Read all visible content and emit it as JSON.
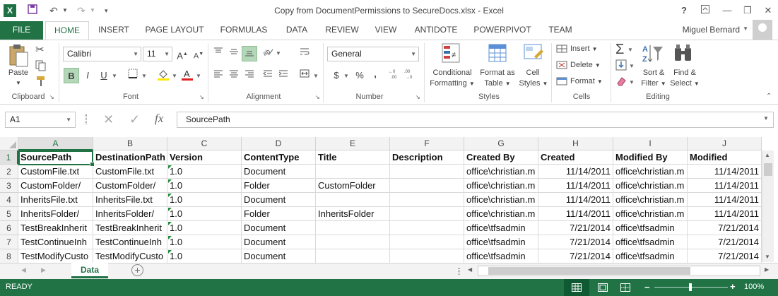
{
  "window": {
    "title": "Copy from DocumentPermissions to SecureDocs.xlsx - Excel",
    "app_icon_letter": "X",
    "help": "?"
  },
  "tabs": [
    "FILE",
    "HOME",
    "INSERT",
    "PAGE LAYOUT",
    "FORMULAS",
    "DATA",
    "REVIEW",
    "VIEW",
    "ANTIDOTE",
    "POWERPIVOT",
    "TEAM"
  ],
  "user": {
    "name": "Miguel Bernard"
  },
  "ribbon": {
    "clipboard": {
      "label": "Clipboard",
      "paste": "Paste"
    },
    "font": {
      "label": "Font",
      "name": "Calibri",
      "size": "11",
      "bold": "B",
      "italic": "I",
      "underline": "U"
    },
    "alignment": {
      "label": "Alignment"
    },
    "number": {
      "label": "Number",
      "format": "General",
      "currency": "$",
      "percent": "%",
      "comma": ","
    },
    "styles": {
      "label": "Styles",
      "conditional": [
        "Conditional",
        "Formatting"
      ],
      "format_table": [
        "Format as",
        "Table"
      ],
      "cell_styles": [
        "Cell",
        "Styles"
      ]
    },
    "cells": {
      "label": "Cells",
      "insert": "Insert",
      "delete": "Delete",
      "format": "Format"
    },
    "editing": {
      "label": "Editing",
      "sort": [
        "Sort &",
        "Filter"
      ],
      "find": [
        "Find &",
        "Select"
      ]
    }
  },
  "formula_bar": {
    "name_box": "A1",
    "fx": "fx",
    "content": "SourcePath"
  },
  "grid": {
    "columns": [
      "A",
      "B",
      "C",
      "D",
      "E",
      "F",
      "G",
      "H",
      "I",
      "J"
    ],
    "rows": [
      [
        "SourcePath",
        "DestinationPath",
        "Version",
        "ContentType",
        "Title",
        "Description",
        "Created By",
        "Created",
        "Modified By",
        "Modified"
      ],
      [
        "CustomFile.txt",
        "CustomFile.txt",
        "1.0",
        "Document",
        "",
        "",
        "office\\christian.m",
        "11/14/2011",
        "office\\christian.m",
        "11/14/2011"
      ],
      [
        "CustomFolder/",
        "CustomFolder/",
        "1.0",
        "Folder",
        "CustomFolder",
        "",
        "office\\christian.m",
        "11/14/2011",
        "office\\christian.m",
        "11/14/2011"
      ],
      [
        "InheritsFile.txt",
        "InheritsFile.txt",
        "1.0",
        "Document",
        "",
        "",
        "office\\christian.m",
        "11/14/2011",
        "office\\christian.m",
        "11/14/2011"
      ],
      [
        "InheritsFolder/",
        "InheritsFolder/",
        "1.0",
        "Folder",
        "InheritsFolder",
        "",
        "office\\christian.m",
        "11/14/2011",
        "office\\christian.m",
        "11/14/2011"
      ],
      [
        "TestBreakInherit",
        "TestBreakInherit",
        "1.0",
        "Document",
        "",
        "",
        "office\\tfsadmin",
        "7/21/2014",
        "office\\tfsadmin",
        "7/21/2014"
      ],
      [
        "TestContinueInh",
        "TestContinueInh",
        "1.0",
        "Document",
        "",
        "",
        "office\\tfsadmin",
        "7/21/2014",
        "office\\tfsadmin",
        "7/21/2014"
      ],
      [
        "TestModifyCusto",
        "TestModifyCusto",
        "1.0",
        "Document",
        "",
        "",
        "office\\tfsadmin",
        "7/21/2014",
        "office\\tfsadmin",
        "7/21/2014"
      ]
    ]
  },
  "sheet": {
    "active_tab": "Data"
  },
  "status": {
    "mode": "READY",
    "zoom": "100%"
  },
  "colors": {
    "accent": "#217346"
  }
}
